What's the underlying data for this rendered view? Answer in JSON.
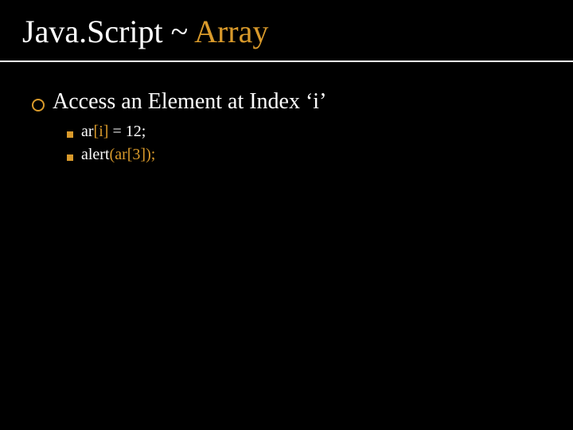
{
  "title": {
    "part1": "Java.",
    "part2": "Script",
    "sep": " ~ ",
    "topic": "Array"
  },
  "bullets": {
    "lvl1": {
      "text": "Access an Element at Index ‘i’"
    },
    "lvl2": [
      {
        "pre": "ar",
        "hl1": "[i]",
        "mid": " = 12;",
        "open": "",
        "arg": "",
        "close": ""
      },
      {
        "pre": "alert",
        "hl1": "",
        "mid": "",
        "open": "(",
        "arg": "ar[3]",
        "close": ");"
      }
    ]
  }
}
